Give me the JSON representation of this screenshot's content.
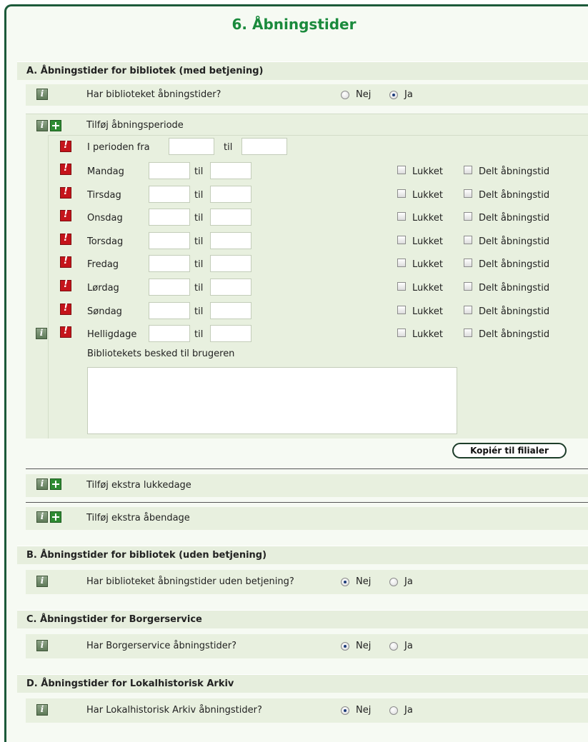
{
  "page_title": "6. Åbningstider",
  "section_a": {
    "title": "A. Åbningstider for bibliotek (med betjening)",
    "question": "Har biblioteket åbningstider?",
    "option_no": "Nej",
    "option_yes": "Ja",
    "selected": "Ja",
    "add_period": "Tilføj åbningsperiode",
    "period_from": "I perioden fra",
    "period_to": "til",
    "days": [
      {
        "label": "Mandag"
      },
      {
        "label": "Tirsdag"
      },
      {
        "label": "Onsdag"
      },
      {
        "label": "Torsdag"
      },
      {
        "label": "Fredag"
      },
      {
        "label": "Lørdag"
      },
      {
        "label": "Søndag"
      },
      {
        "label": "Helligdage"
      }
    ],
    "til_label": "til",
    "closed_label": "Lukket",
    "split_label": "Delt åbningstid",
    "message_label": "Bibliotekets besked til brugeren",
    "message_value": "",
    "copy_button": "Kopiér til filialer",
    "extra_closed": "Tilføj ekstra lukkedage",
    "extra_open": "Tilføj ekstra åbendage"
  },
  "section_b": {
    "title": "B. Åbningstider for bibliotek (uden betjening)",
    "question": "Har biblioteket åbningstider uden betjening?",
    "option_no": "Nej",
    "option_yes": "Ja",
    "selected": "Nej"
  },
  "section_c": {
    "title": "C. Åbningstider for Borgerservice",
    "question": "Har Borgerservice åbningstider?",
    "option_no": "Nej",
    "option_yes": "Ja",
    "selected": "Nej"
  },
  "section_d": {
    "title": "D. Åbningstider for Lokalhistorisk Arkiv",
    "question": "Har Lokalhistorisk Arkiv åbningstider?",
    "option_no": "Nej",
    "option_yes": "Ja",
    "selected": "Nej"
  },
  "icons": {
    "info": "info-icon",
    "add": "plus-icon",
    "required": "exclamation-icon"
  },
  "colors": {
    "title_green": "#1a8a3c",
    "frame": "#1d5a3a",
    "panel": "#e8f0df",
    "header": "#e6eedd"
  }
}
